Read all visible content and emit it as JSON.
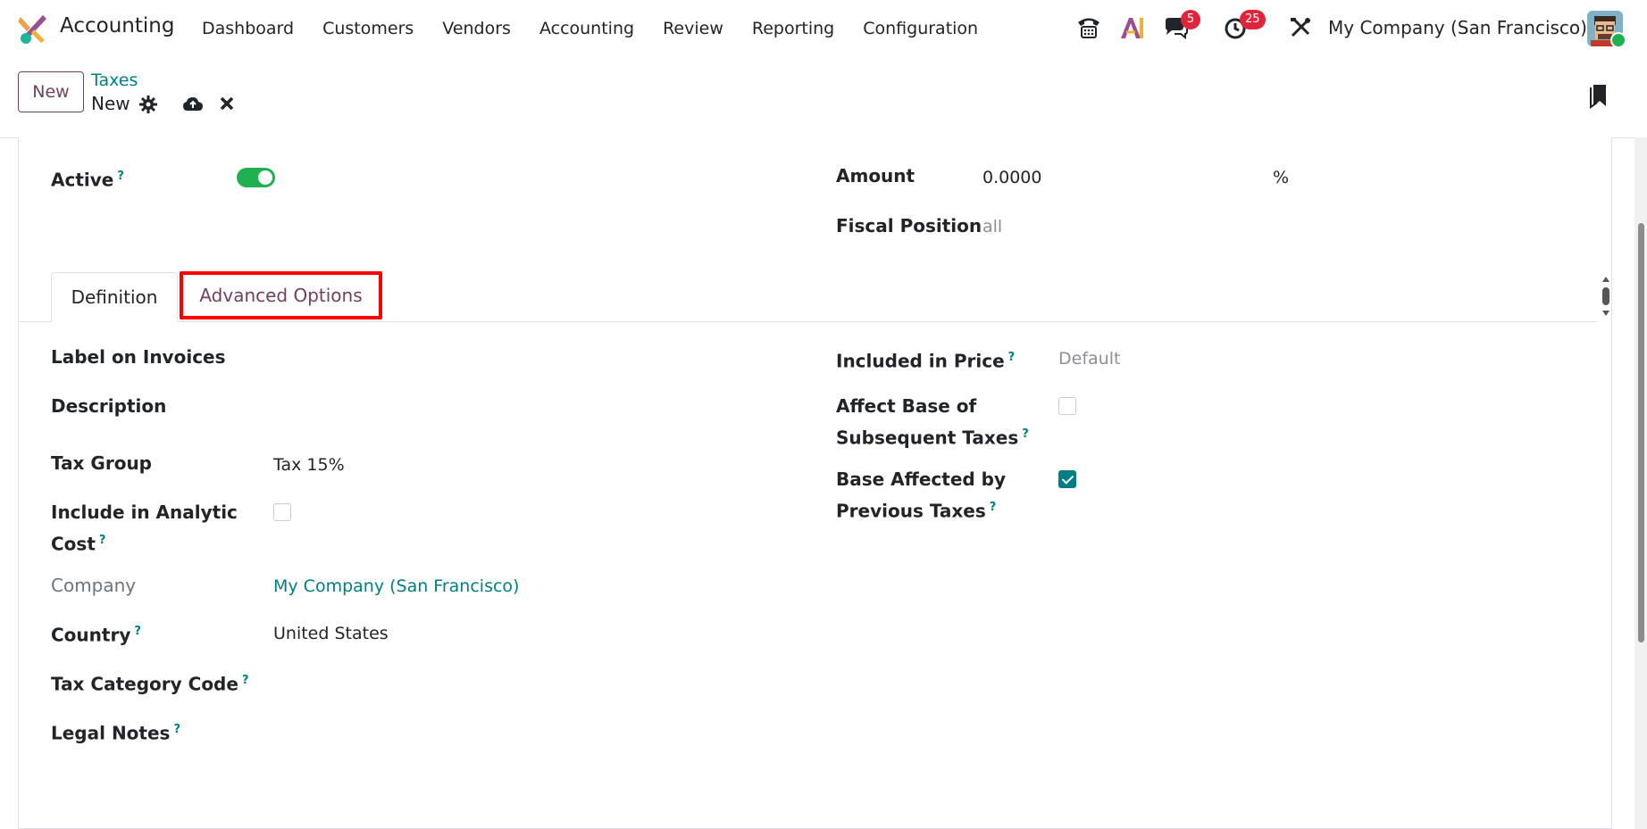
{
  "app": {
    "name": "Accounting"
  },
  "menu": [
    {
      "label": "Dashboard"
    },
    {
      "label": "Customers"
    },
    {
      "label": "Vendors"
    },
    {
      "label": "Accounting"
    },
    {
      "label": "Review"
    },
    {
      "label": "Reporting"
    },
    {
      "label": "Configuration"
    }
  ],
  "systray": {
    "messages_badge": "5",
    "activities_badge": "25",
    "company": "My Company (San Francisco)"
  },
  "controlpanel": {
    "new_label": "New",
    "breadcrumb_parent": "Taxes",
    "breadcrumb_current": "New"
  },
  "form": {
    "active_label": "Active",
    "active_value": true,
    "amount_label": "Amount",
    "amount_value": "0.0000",
    "amount_unit": "%",
    "fiscal_position_label": "Fiscal Position",
    "fiscal_position_value": "all"
  },
  "tabs": [
    {
      "label": "Definition"
    },
    {
      "label": "Advanced Options"
    }
  ],
  "advanced": {
    "label_on_invoices": "Label on Invoices",
    "description": "Description",
    "tax_group_label": "Tax Group",
    "tax_group_value": "Tax 15%",
    "analytic_label_1": "Include in Analytic",
    "analytic_label_2": "Cost",
    "analytic_checked": false,
    "company_label": "Company",
    "company_value": "My Company (San Francisco)",
    "country_label": "Country",
    "country_value": "United States",
    "tax_category_label": "Tax Category Code",
    "legal_notes_label": "Legal Notes",
    "included_in_price_label": "Included in Price",
    "included_in_price_value": "Default",
    "affect_base_label_1": "Affect Base of",
    "affect_base_label_2": "Subsequent Taxes",
    "affect_base_checked": false,
    "base_affected_label_1": "Base Affected by",
    "base_affected_label_2": "Previous Taxes",
    "base_affected_checked": true
  },
  "colors": {
    "brand": "#71405f",
    "link": "#017e84",
    "toggle_on": "#21b04f",
    "badge": "#e0243b",
    "highlight": "#ff0000"
  }
}
